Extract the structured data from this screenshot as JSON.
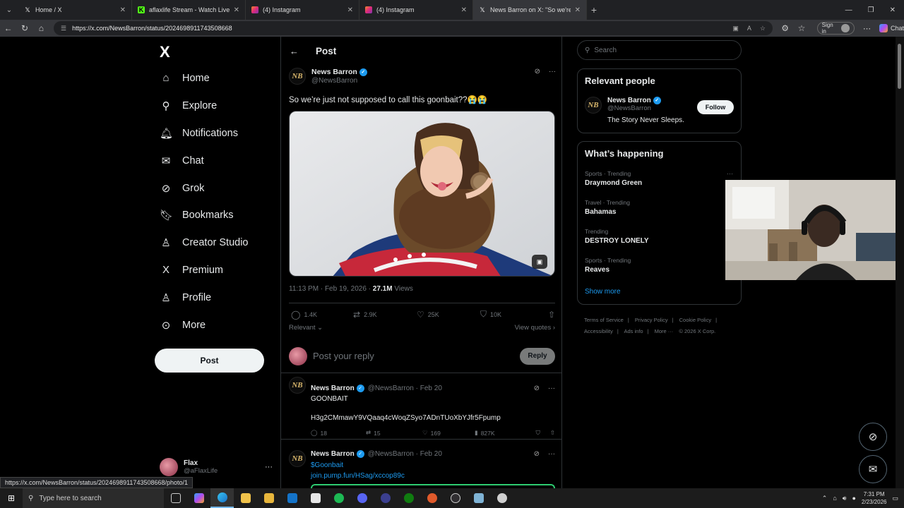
{
  "browser": {
    "tabs": [
      {
        "title": "Home / X",
        "favicon": "x-icon",
        "color": "#000000"
      },
      {
        "title": "aflaxlife Stream - Watch Live on Ki",
        "favicon": "kick-icon",
        "color": "#53fc18"
      },
      {
        "title": "(4) Instagram",
        "favicon": "instagram-icon",
        "color": "#e1306c"
      },
      {
        "title": "(4) Instagram",
        "favicon": "instagram-icon",
        "color": "#e1306c"
      },
      {
        "title": "News Barron on X: \"So we're just n",
        "favicon": "x-icon",
        "color": "#000000"
      }
    ],
    "url": "https://x.com/NewsBarron/status/2024698911743508668",
    "signin_label": "Sign in",
    "copilot_label": "Chat",
    "status_url": "https://x.com/NewsBarron/status/2024698911743508668/photo/1"
  },
  "sidebar": {
    "logo": "X",
    "items": [
      {
        "label": "Home",
        "icon": "home-icon",
        "glyph": "⌂"
      },
      {
        "label": "Explore",
        "icon": "search-icon",
        "glyph": "⚲"
      },
      {
        "label": "Notifications",
        "icon": "bell-icon",
        "glyph": "🔔︎"
      },
      {
        "label": "Chat",
        "icon": "mail-icon",
        "glyph": "✉"
      },
      {
        "label": "Grok",
        "icon": "grok-icon",
        "glyph": "⊘"
      },
      {
        "label": "Bookmarks",
        "icon": "bookmark-icon",
        "glyph": "🔖︎"
      },
      {
        "label": "Creator Studio",
        "icon": "creator-studio-icon",
        "glyph": "♙"
      },
      {
        "label": "Premium",
        "icon": "x-premium-icon",
        "glyph": "X"
      },
      {
        "label": "Profile",
        "icon": "person-icon",
        "glyph": "♙"
      },
      {
        "label": "More",
        "icon": "more-circle-icon",
        "glyph": "⋯"
      }
    ],
    "post_button": "Post",
    "account": {
      "name": "Flax",
      "handle": "@aFlaxLife"
    }
  },
  "post": {
    "header_title": "Post",
    "author_name": "News Barron",
    "author_handle": "@NewsBarron",
    "avatar_text": "NB",
    "text": "So we’re just not supposed to call this goonbait??😭😭",
    "time": "11:13 PM · Feb 19, 2026 · ",
    "views_count": "27.1M",
    "views_label": " Views",
    "stats": {
      "replies": "1.4K",
      "reposts": "2.9K",
      "likes": "25K",
      "bookmarks": "10K"
    },
    "sort_label": "Relevant ⌄",
    "view_quotes": "View quotes ›",
    "reply_placeholder": "Post your reply",
    "reply_button": "Reply"
  },
  "replies": [
    {
      "name": "News Barron",
      "handle": "@NewsBarron · Feb 20",
      "line1": "GOONBAIT",
      "line2": "H3g2CMmawY9VQaaq4cWoqZSyo7ADnTUoXbYJfr5Fpump",
      "stats": {
        "replies": "18",
        "reposts": "15",
        "likes": "169",
        "views": "827K"
      }
    },
    {
      "name": "News Barron",
      "handle": "@NewsBarron · Feb 20",
      "line1": "$Goonbait",
      "line2": "join.pump.fun/HSag/xccop89c"
    }
  ],
  "right": {
    "search_placeholder": "Search",
    "relevant_title": "Relevant people",
    "person": {
      "name": "News Barron",
      "handle": "@NewsBarron",
      "bio": "The Story Never Sleeps.",
      "follow": "Follow"
    },
    "happening_title": "What’s happening",
    "trends": [
      {
        "context": "Sports · Trending",
        "title": "Draymond Green"
      },
      {
        "context": "Travel · Trending",
        "title": "Bahamas"
      },
      {
        "context": "Trending",
        "title": "DESTROY LONELY"
      },
      {
        "context": "Sports · Trending",
        "title": "Reaves"
      }
    ],
    "show_more": "Show more",
    "footer": [
      "Terms of Service",
      "|",
      "Privacy Policy",
      "|",
      "Cookie Policy",
      "|",
      "Accessibility",
      "|",
      "Ads info",
      "|",
      "More ···",
      "© 2026 X Corp."
    ]
  },
  "taskbar": {
    "search_placeholder": "Type here to search",
    "time": "7:31 PM",
    "date": "2/23/2026"
  },
  "colors": {
    "accent": "#1d9bf0",
    "background": "#000000",
    "border": "#2f3336",
    "muted": "#71767b"
  }
}
